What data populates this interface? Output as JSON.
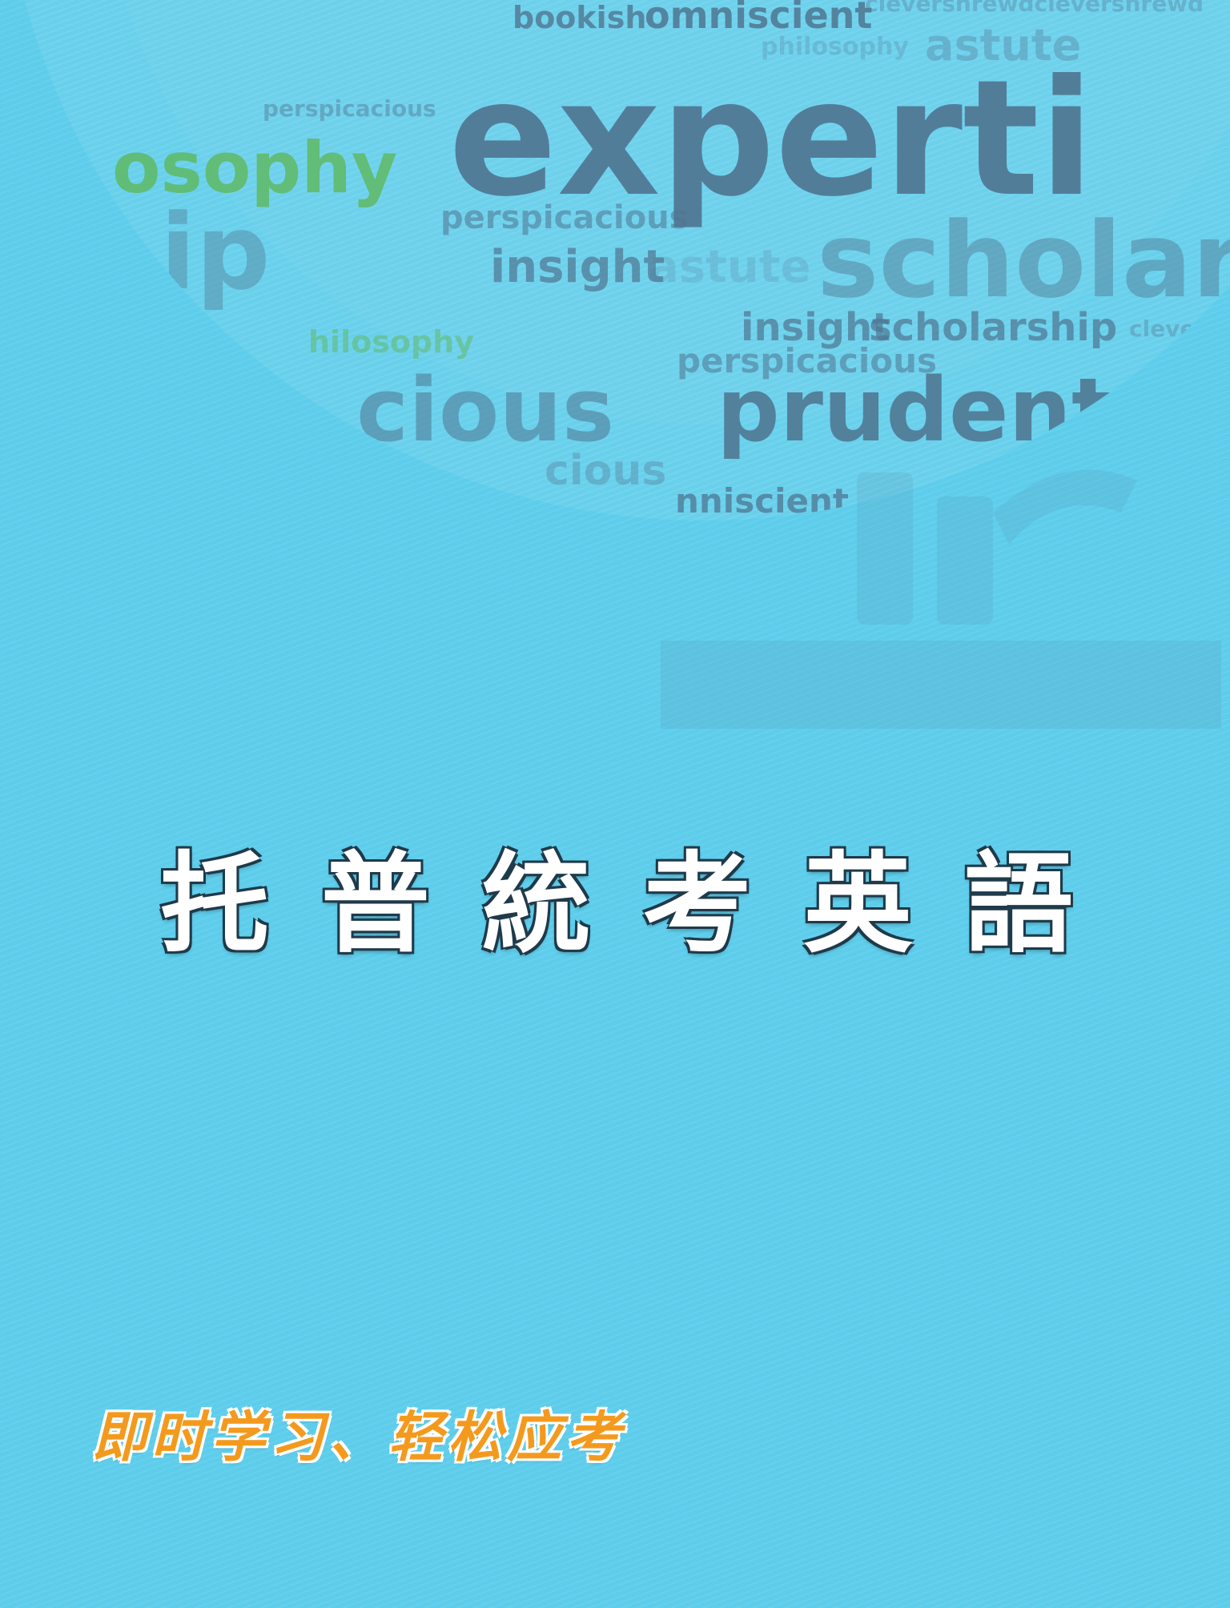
{
  "cover": {
    "background_color": "#5dcdeb",
    "word_cloud": {
      "words": [
        "bookish",
        "omniscient",
        "clevershrewdclevershrewd",
        "philosophy",
        "astute",
        "perspicacious",
        "experti",
        "osophy",
        "ip",
        "perspicacious",
        "insight",
        "astute",
        "scholar",
        "insight",
        "scholarship",
        "clevers",
        "hilosophy",
        "perspicacious",
        "cle",
        "cious",
        "prudent",
        "cious",
        "nniscient"
      ]
    },
    "title_chars": [
      "托",
      "普",
      "統",
      "考",
      "英",
      "語"
    ],
    "slogan": "即时学习、轻松应考",
    "colors": {
      "title_fill": "#ffffff",
      "slogan_fill": "#f39a1e",
      "cloud_word": "#4f7591",
      "cloud_accent": "#5fba6a"
    }
  }
}
